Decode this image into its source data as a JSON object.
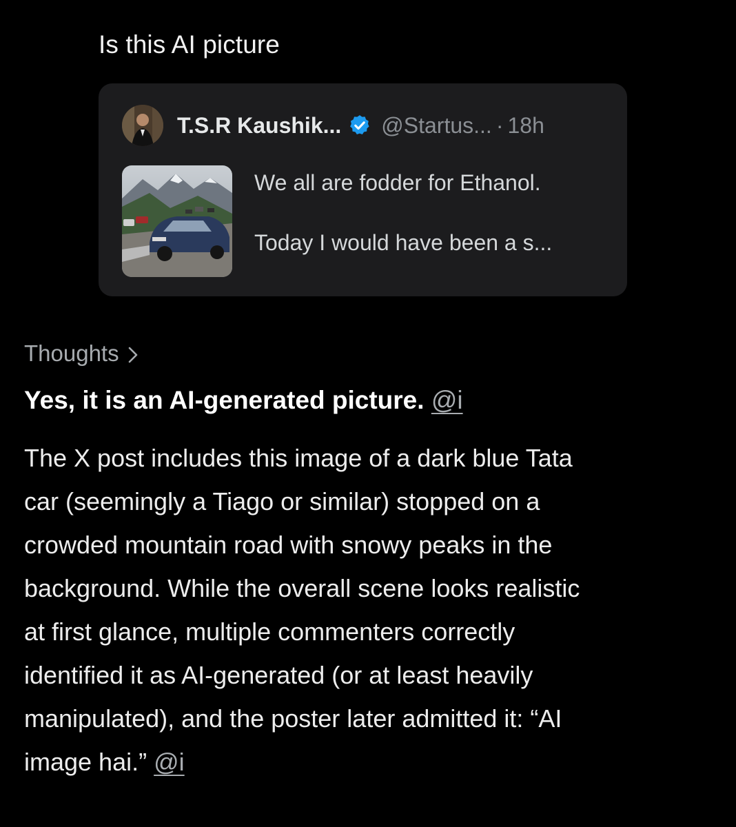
{
  "prompt": {
    "text": "Is this AI picture"
  },
  "quoted_post": {
    "author": "T.S.R Kaushik...",
    "verified_icon": "verified-badge-icon",
    "handle": "@Startus...",
    "separator": "·",
    "time": "18h",
    "snippet_line1": "We all are fodder for Ethanol.",
    "snippet_line2": "Today I would have been a s..."
  },
  "thoughts": {
    "label": "Thoughts",
    "icon": "chevron-right-icon"
  },
  "answer": {
    "headline": "Yes, it is an AI-generated picture.",
    "headline_citation": "@i",
    "body_lines": [
      "The X post includes this image of a dark blue Tata",
      "car (seemingly a Tiago or similar) stopped on a",
      "crowded mountain road with snowy peaks in the",
      "background. While the overall scene looks realistic",
      "at first glance, multiple commenters correctly",
      "identified it as AI-generated (or at least heavily",
      "manipulated), and the poster later admitted it: “AI",
      "image hai.”"
    ],
    "body_citation": "@i"
  },
  "colors": {
    "background": "#000000",
    "card_background": "#1c1c1e",
    "verified_blue": "#1d9bf0",
    "muted_text": "#8b8f94"
  }
}
